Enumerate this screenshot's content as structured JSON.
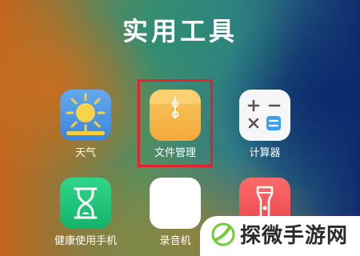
{
  "folder": {
    "title": "实用工具"
  },
  "apps": [
    {
      "label": "天气",
      "icon": "weather-sun-icon"
    },
    {
      "label": "文件管理",
      "icon": "file-manager-icon",
      "highlighted": true
    },
    {
      "label": "计算器",
      "icon": "calculator-icon"
    },
    {
      "label": "健康使用手机",
      "icon": "hourglass-icon"
    },
    {
      "label": "录音机",
      "icon": "sound-wave-icon"
    },
    {
      "label": "",
      "icon": "flashlight-icon"
    }
  ],
  "watermark": {
    "text": "探微手游网"
  },
  "colors": {
    "highlight": "#e0232f",
    "weather": "#3b86dc",
    "file_manager": "#f2a93c",
    "calculator_accent": "#3aa0f2",
    "health": "#14b36c",
    "flashlight": "#e8454a"
  }
}
